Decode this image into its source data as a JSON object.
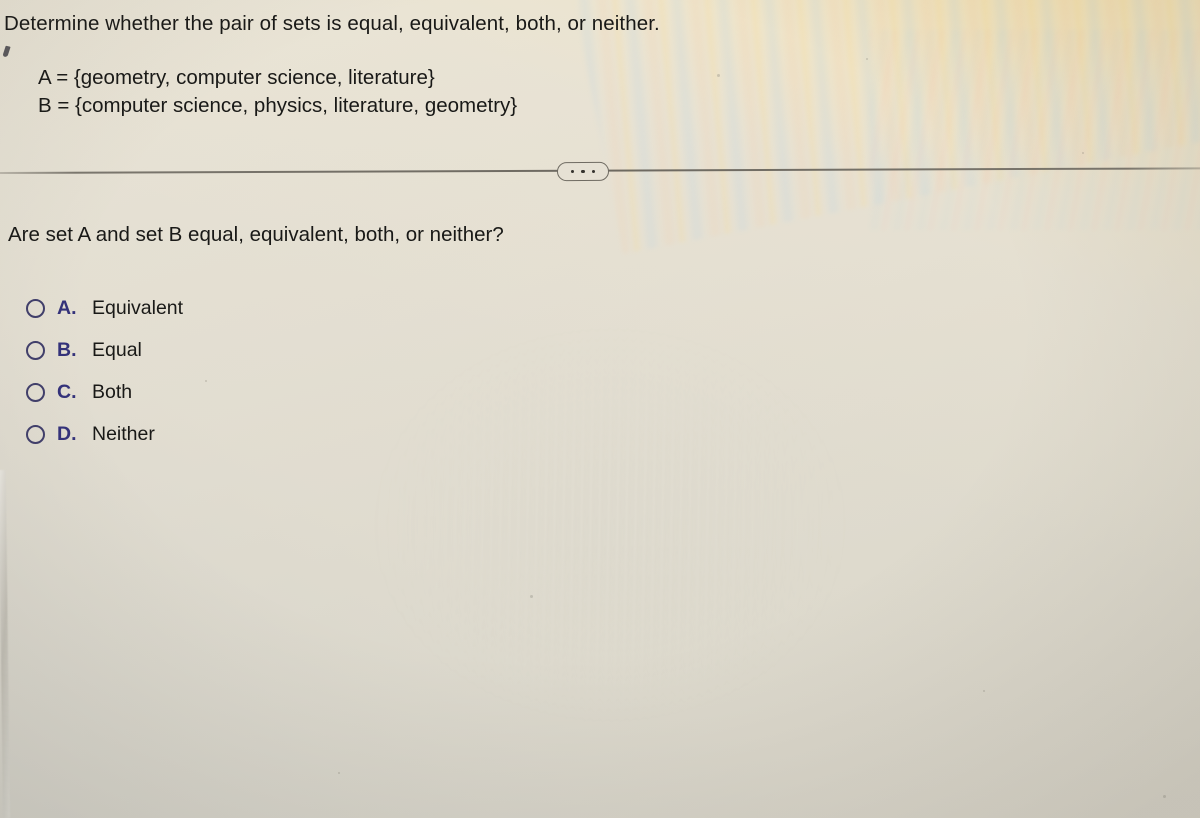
{
  "prompt": "Determine whether the pair of sets is equal, equivalent, both, or neither.",
  "sets": {
    "a": "A = {geometry, computer science, literature}",
    "b": "B = {computer science, physics, literature, geometry}"
  },
  "divider": {
    "ellipsis_label": "..."
  },
  "question": "Are set A and set B equal, equivalent, both, or neither?",
  "options": [
    {
      "letter": "A.",
      "label": "Equivalent",
      "selected": false
    },
    {
      "letter": "B.",
      "label": "Equal",
      "selected": false
    },
    {
      "letter": "C.",
      "label": "Both",
      "selected": false
    },
    {
      "letter": "D.",
      "label": "Neither",
      "selected": false
    }
  ],
  "colors": {
    "background": "#e4dfd2",
    "text": "#191917",
    "option_letter": "#34327a",
    "radio_outline": "#413f6b",
    "divider": "#605c54"
  }
}
